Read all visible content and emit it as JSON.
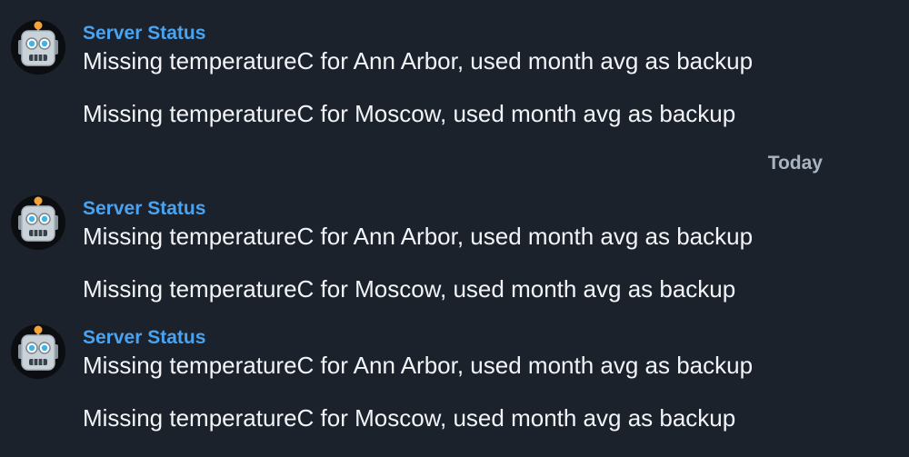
{
  "messages": [
    {
      "sender": "Server Status",
      "lines": [
        "Missing temperatureC for Ann Arbor, used month avg as backup",
        "Missing temperatureC for Moscow, used month avg as backup"
      ],
      "avatar_icon": "robot-icon"
    },
    {
      "sender": "Server Status",
      "lines": [
        "Missing temperatureC for Ann Arbor, used month avg as backup",
        "Missing temperatureC for Moscow, used month avg as backup"
      ],
      "avatar_icon": "robot-icon"
    },
    {
      "sender": "Server Status",
      "lines": [
        "Missing temperatureC for Ann Arbor, used month avg as backup",
        "Missing temperatureC for Moscow, used month avg as backup"
      ],
      "avatar_icon": "robot-icon"
    }
  ],
  "date_separator": "Today",
  "colors": {
    "background": "#1b222c",
    "sender_name": "#4aa3f0",
    "message_text": "#f2f4f7",
    "date_separator": "#aab4c1"
  }
}
